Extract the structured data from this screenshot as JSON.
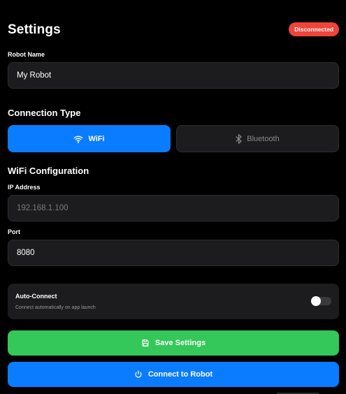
{
  "header": {
    "title": "Settings",
    "status": "Disconnected"
  },
  "robot_name": {
    "label": "Robot Name",
    "value": "My Robot"
  },
  "connection": {
    "title": "Connection Type",
    "options": [
      {
        "label": "WiFi",
        "icon": "wifi-icon",
        "selected": true
      },
      {
        "label": "Bluetooth",
        "icon": "bluetooth-icon",
        "selected": false
      }
    ]
  },
  "wifi": {
    "title": "WiFi Configuration",
    "ip_label": "IP Address",
    "ip_value": "",
    "ip_placeholder": "192.168.1.100",
    "port_label": "Port",
    "port_value": "8080"
  },
  "auto_connect": {
    "title": "Auto-Connect",
    "description": "Connect automatically on app launch",
    "enabled": false
  },
  "actions": {
    "save_label": "Save Settings",
    "connect_label": "Connect to Robot"
  },
  "colors": {
    "accent_blue": "#0a7cff",
    "save_green": "#34c759",
    "badge_red": "#f04438",
    "card_bg": "#1c1c1e"
  }
}
